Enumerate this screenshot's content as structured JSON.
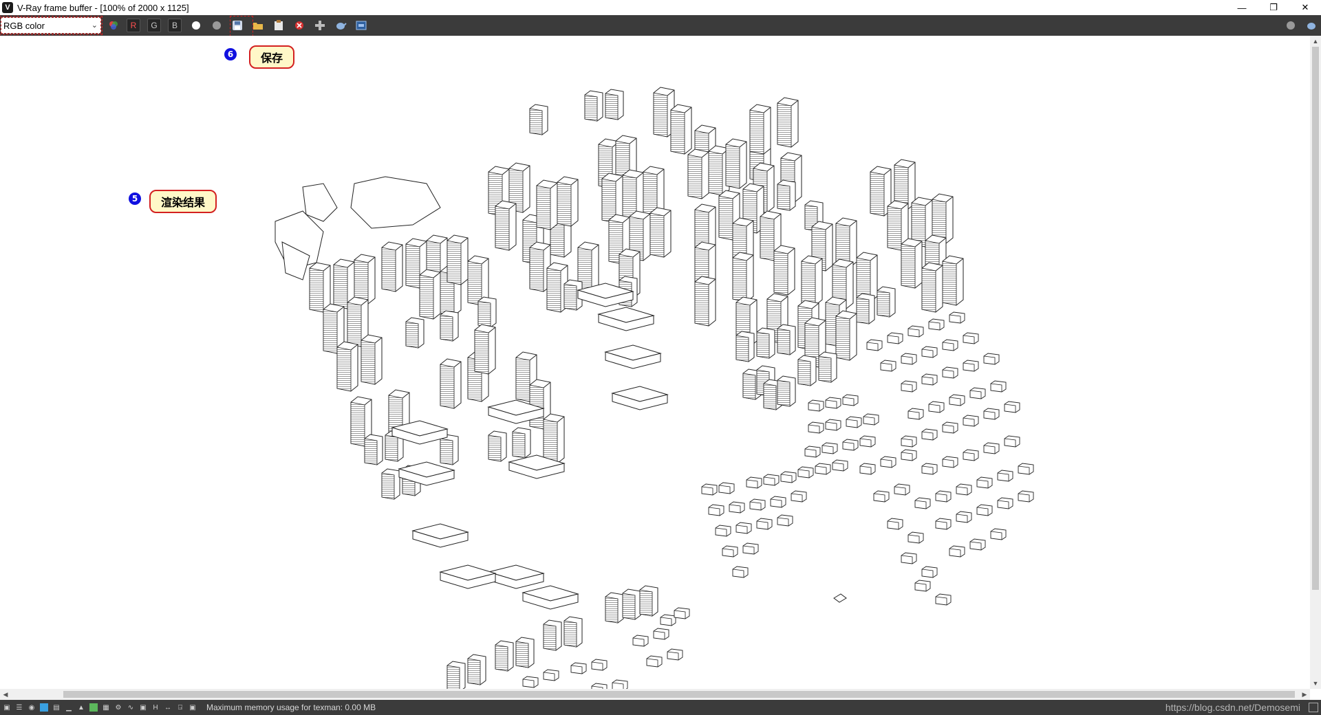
{
  "window": {
    "title": "V-Ray frame buffer - [100% of 2000 x 1125]",
    "app_icon": "vray-logo-icon",
    "controls": [
      "minimize",
      "restore",
      "close"
    ]
  },
  "toolbar": {
    "channel_value": "RGB color",
    "r_label": "R",
    "g_label": "G",
    "b_label": "B",
    "icons": [
      "color-mode-icon",
      "white-dot-icon",
      "grey-dot-icon",
      "save-icon",
      "open-folder-icon",
      "clipboard-icon",
      "clear-icon",
      "track-mouse-icon",
      "teapot-icon",
      "vfb-history-icon"
    ],
    "right_icons": [
      "render-settings-icon",
      "render-icon"
    ]
  },
  "annotations": {
    "save_badge": "6",
    "save_label": "保存",
    "render_badge": "5",
    "render_label": "渲染结果"
  },
  "status": {
    "memory_text": "Maximum memory usage for texman: 0.00 MB",
    "watermark": "https://blog.csdn.net/Demosemi"
  }
}
